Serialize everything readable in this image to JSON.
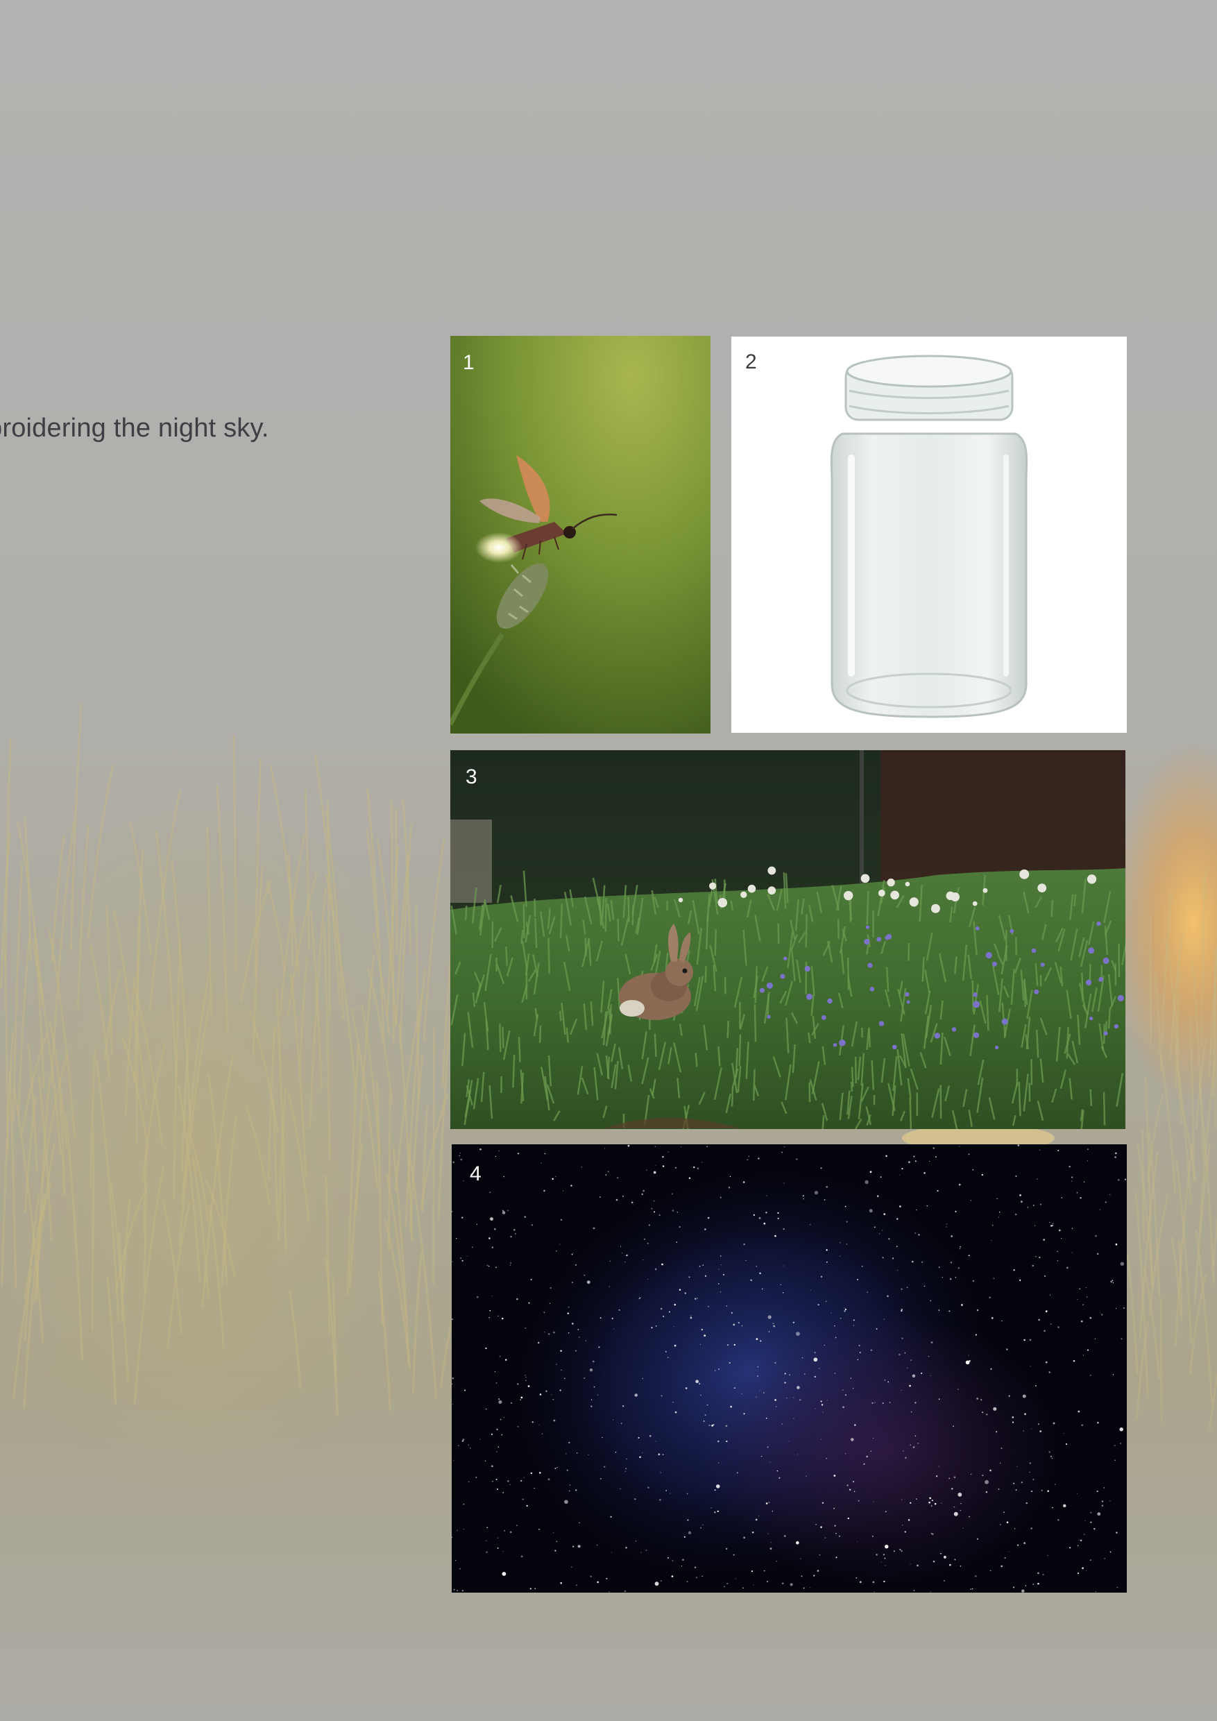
{
  "caption": "broidering the night sky.",
  "photos": [
    {
      "number": "1",
      "subject": "firefly-on-plant"
    },
    {
      "number": "2",
      "subject": "empty-glass-jar"
    },
    {
      "number": "3",
      "subject": "rabbit-in-grass"
    },
    {
      "number": "4",
      "subject": "starry-night-sky"
    }
  ],
  "colors": {
    "page_background": "#b1b0ae",
    "caption_text": "#3f3e44",
    "number_light": "#ffffff",
    "number_dark": "#3a3a3a"
  }
}
